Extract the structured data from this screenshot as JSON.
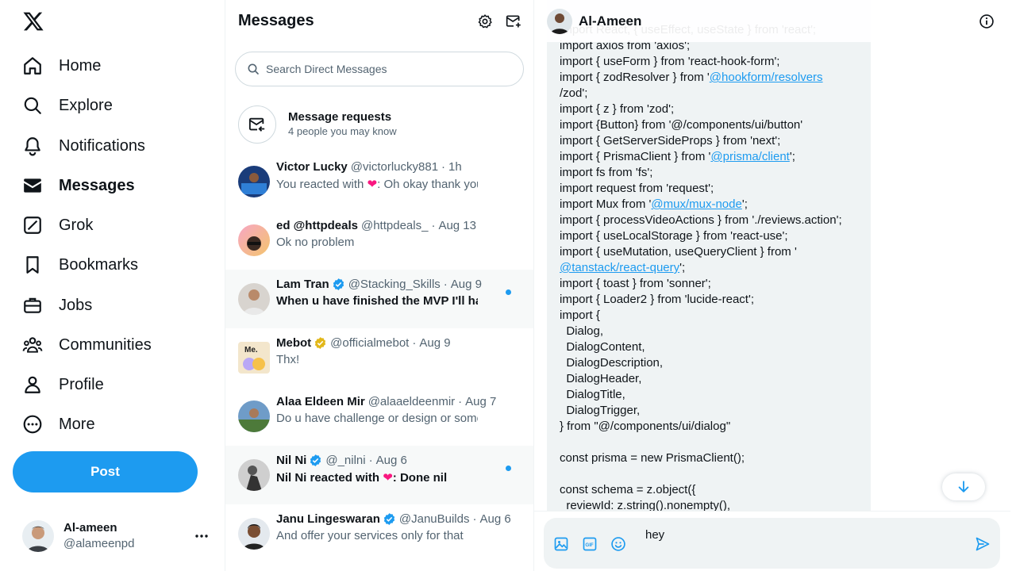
{
  "nav": {
    "items": [
      {
        "label": "Home",
        "icon": "home-icon"
      },
      {
        "label": "Explore",
        "icon": "search-icon"
      },
      {
        "label": "Notifications",
        "icon": "bell-icon"
      },
      {
        "label": "Messages",
        "icon": "envelope-icon"
      },
      {
        "label": "Grok",
        "icon": "grok-icon"
      },
      {
        "label": "Bookmarks",
        "icon": "bookmark-icon"
      },
      {
        "label": "Jobs",
        "icon": "briefcase-icon"
      },
      {
        "label": "Communities",
        "icon": "people-icon"
      },
      {
        "label": "Profile",
        "icon": "person-icon"
      },
      {
        "label": "More",
        "icon": "more-circle-icon"
      }
    ],
    "post_label": "Post",
    "account": {
      "name": "Al-ameen",
      "handle": "@alameenpd"
    }
  },
  "messages_panel": {
    "title": "Messages",
    "search_placeholder": "Search Direct Messages",
    "requests": {
      "title": "Message requests",
      "subtitle": "4 people you may know"
    },
    "conversations": [
      {
        "name": "Victor Lucky",
        "handle": "@victorlucky881",
        "time": "1h",
        "preview": "You reacted with ❤️: Oh okay thank you",
        "unread": false,
        "verified": null
      },
      {
        "name": "ed @httpdeals",
        "handle": "@httpdeals_",
        "time": "Aug 13",
        "preview": "Ok no problem",
        "unread": false,
        "verified": null
      },
      {
        "name": "Lam Tran",
        "handle": "@Stacking_Skills",
        "time": "Aug 9",
        "preview": "When u have finished the MVP I'll have a look",
        "unread": true,
        "verified": "blue"
      },
      {
        "name": "Mebot",
        "handle": "@officialmebot",
        "time": "Aug 9",
        "preview": "Thx!",
        "unread": false,
        "verified": "gold"
      },
      {
        "name": "Alaa Eldeen Mir",
        "handle": "@alaaeldeenmir",
        "time": "Aug 7",
        "preview": "Do u have challenge or design or something to share",
        "unread": false,
        "verified": null
      },
      {
        "name": "Nil Ni",
        "handle": "@_nilni",
        "time": "Aug 6",
        "preview": "Nil Ni reacted with ❤️: Done nil",
        "unread": true,
        "verified": "blue"
      },
      {
        "name": "Janu Lingeswaran",
        "handle": "@JanuBuilds",
        "time": "Aug 6",
        "preview": "And offer your services only for that",
        "unread": false,
        "verified": "blue"
      }
    ]
  },
  "chat": {
    "name": "Al-Ameen",
    "code_lines": [
      "import React, { useEffect, useState } from 'react';",
      "import axios from 'axios';",
      "import { useForm } from 'react-hook-form';",
      "import { zodResolver } from '[[@hookform/resolvers]]",
      "/zod';",
      "import { z } from 'zod';",
      "import {Button} from '@/components/ui/button'",
      "import { GetServerSideProps } from 'next';",
      "import { PrismaClient } from '[[@prisma/client]]';",
      "import fs from 'fs';",
      "import request from 'request';",
      "import Mux from '[[@mux/mux-node]]';",
      "import { processVideoActions } from './reviews.action';",
      "import { useLocalStorage } from 'react-use';",
      "import { useMutation, useQueryClient } from '",
      "[[@tanstack/react-query]]';",
      "import { toast } from 'sonner';",
      "import { Loader2 } from 'lucide-react';",
      "import {",
      "  Dialog,",
      "  DialogContent,",
      "  DialogDescription,",
      "  DialogHeader,",
      "  DialogTitle,",
      "  DialogTrigger,",
      "} from \"@/components/ui/dialog\"",
      "",
      "const prisma = new PrismaClient();",
      "",
      "const schema = z.object({",
      "  reviewId: z.string().nonempty(),"
    ],
    "input_value": "hey",
    "colors": {
      "accent": "#1d9bf0",
      "bubble": "#eff3f4"
    }
  }
}
